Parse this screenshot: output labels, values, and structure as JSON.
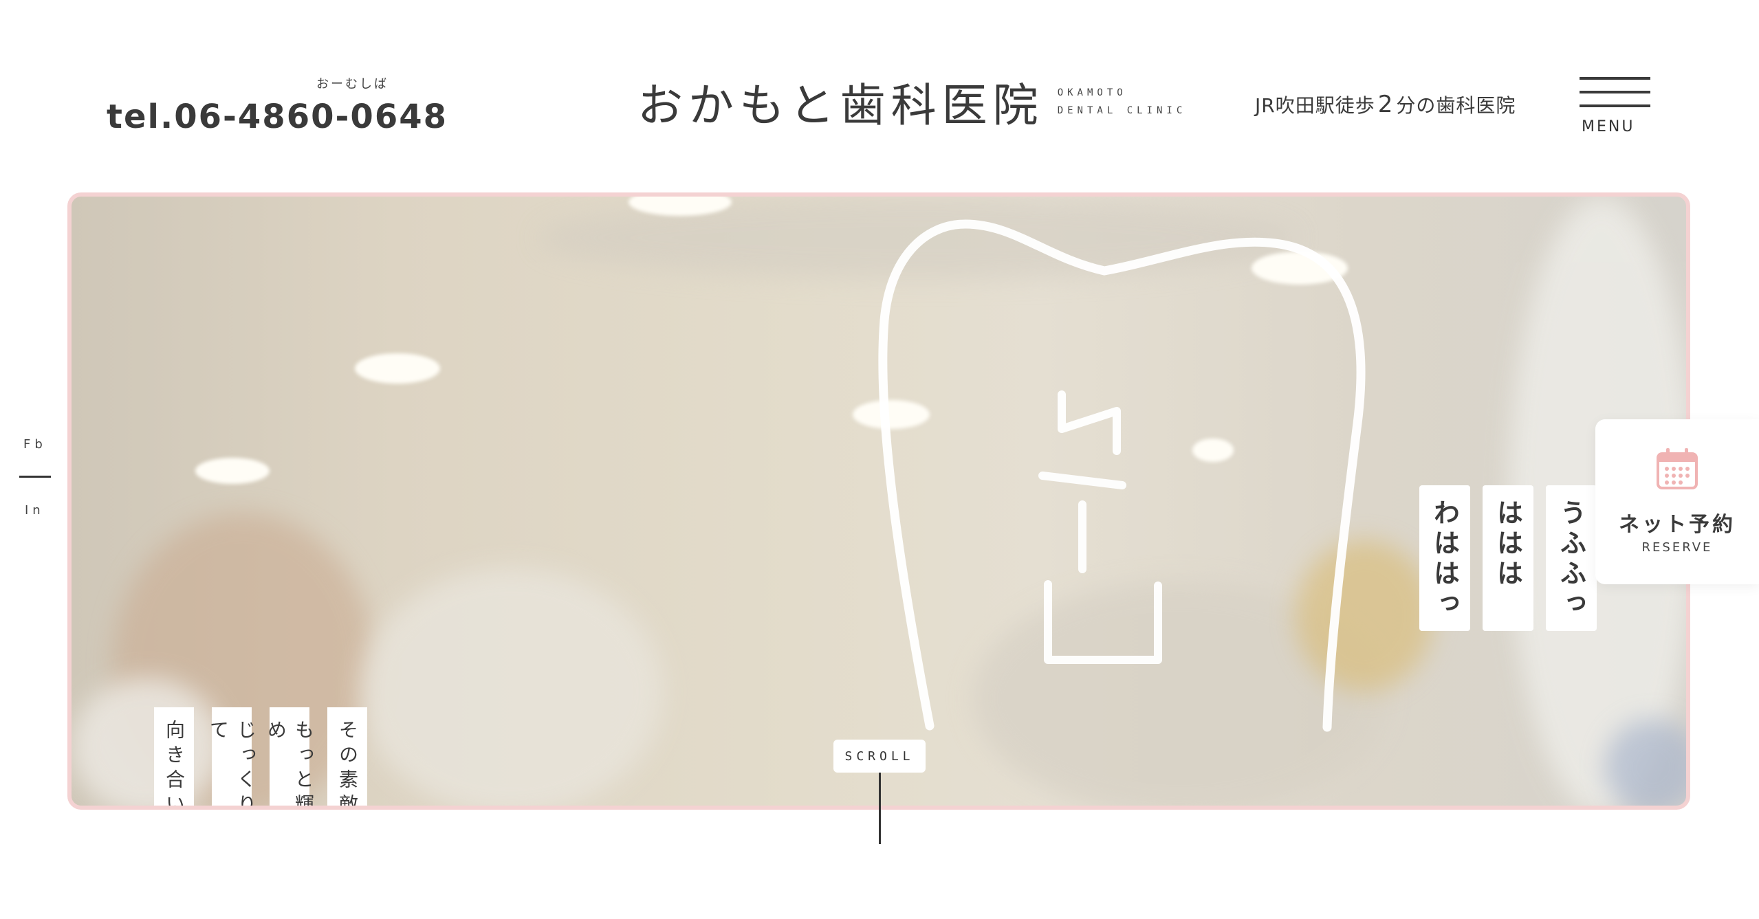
{
  "header": {
    "tel_ruby": "おーむしば",
    "tel": "tel.06-4860-0648",
    "logo_name": "おかもと歯科医院",
    "logo_en_line1": "OKAMOTO",
    "logo_en_line2": "DENTAL CLINIC",
    "access_pre": "JR吹田駅徒歩",
    "access_num": "2",
    "access_post": "分の歯科医院",
    "menu_label": "MENU"
  },
  "hero": {
    "left_copy": [
      "その素敵な笑顔を",
      "もっと輝かせるため",
      "じっくり腰を据えて",
      "向き合いたい。"
    ],
    "right_copy": [
      "うふふっ",
      "ははは",
      "わははっ"
    ],
    "scroll_label": "SCROLL"
  },
  "sns": {
    "fb": "Fb",
    "in": "In"
  },
  "reserve": {
    "jp": "ネット予約",
    "en": "RESERVE"
  },
  "colors": {
    "accent_pink": "#f4d2d2",
    "text": "#3a3a3a",
    "calendar": "#f0b3b3"
  }
}
